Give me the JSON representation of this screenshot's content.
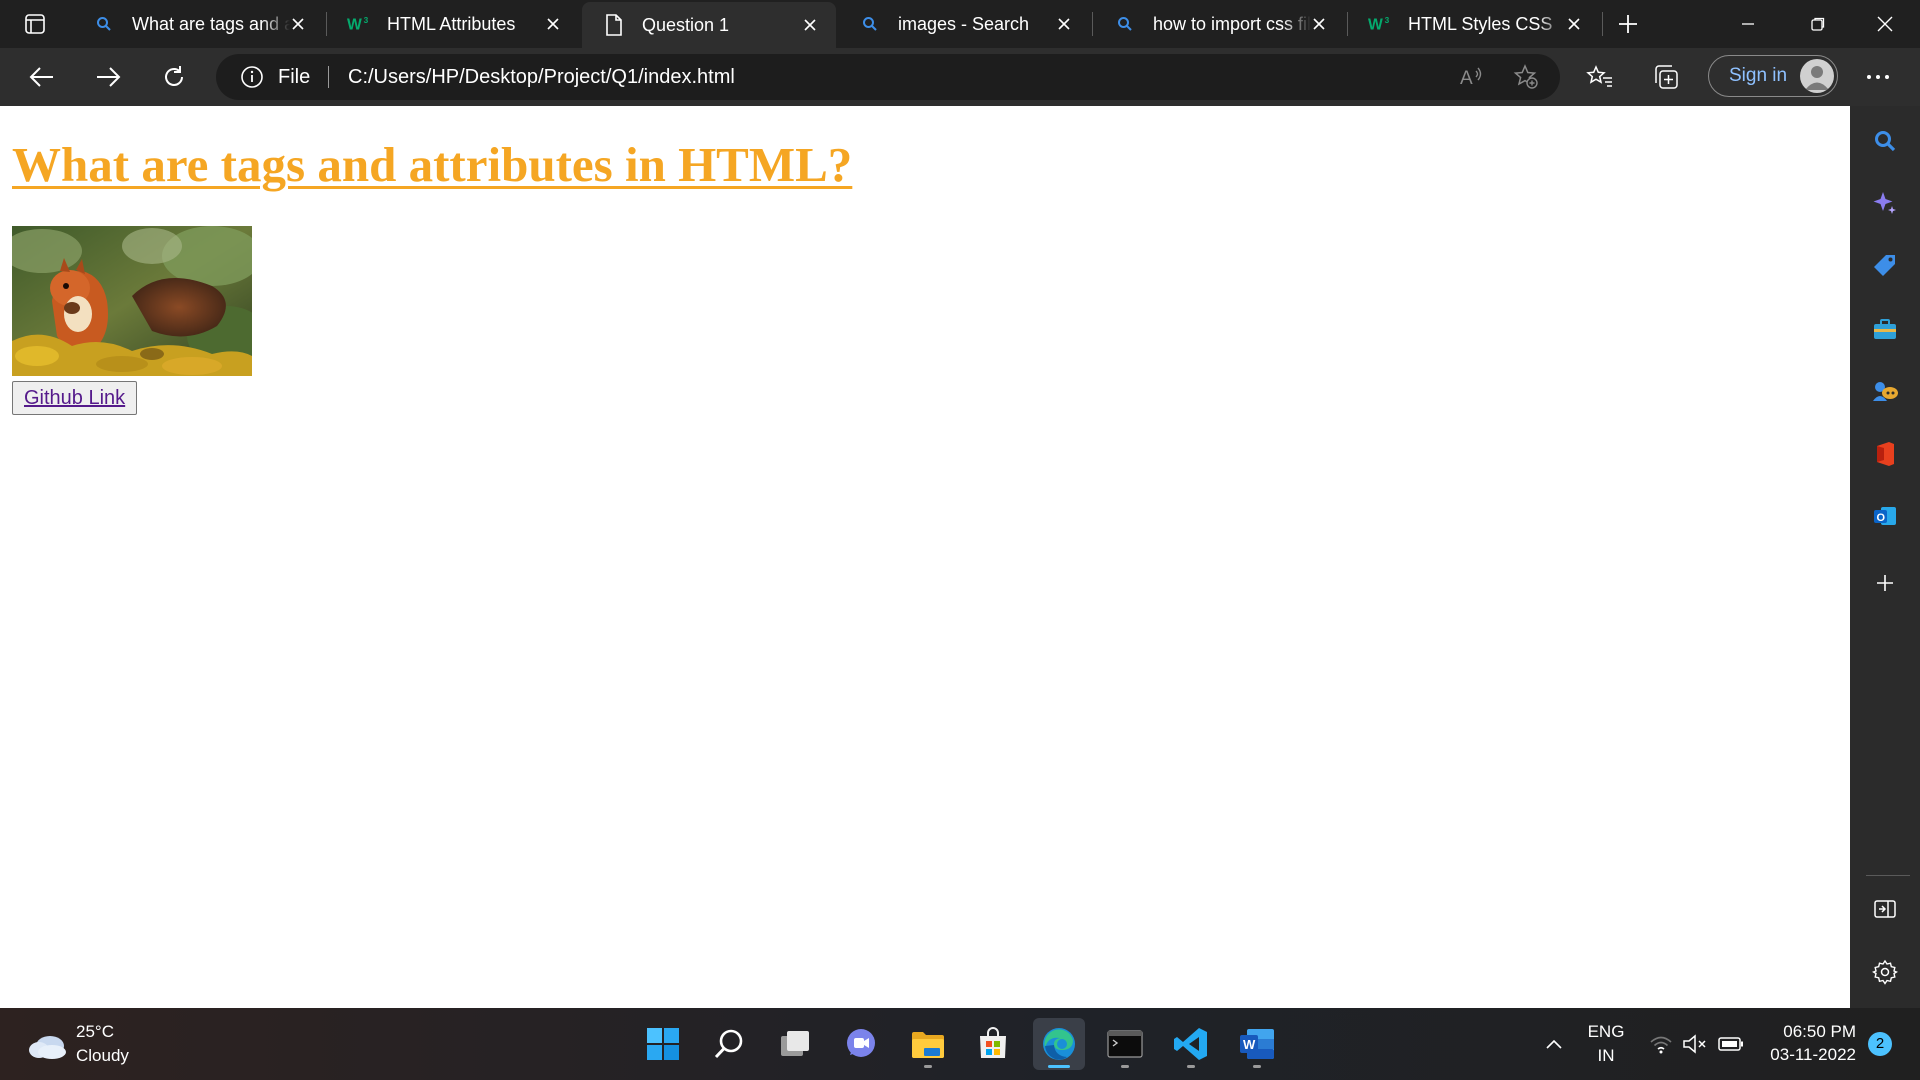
{
  "browser": {
    "tabs": [
      {
        "label": "What are tags and attributes in HTML",
        "icon": "search-icon",
        "active": false
      },
      {
        "label": "HTML Attributes",
        "icon": "w3schools-icon",
        "active": false
      },
      {
        "label": "Question 1",
        "icon": "document-icon",
        "active": true
      },
      {
        "label": "images - Search",
        "icon": "search-icon",
        "active": false
      },
      {
        "label": "how to import css file",
        "icon": "search-icon",
        "active": false
      },
      {
        "label": "HTML Styles CSS",
        "icon": "w3schools-icon",
        "active": false
      }
    ],
    "address": {
      "scheme_label": "File",
      "url": "C:/Users/HP/Desktop/Project/Q1/index.html"
    },
    "signin_label": "Sign in",
    "accent": "#4cc2ff"
  },
  "page": {
    "heading": "What are tags and attributes in HTML?",
    "heading_color": "#f5a623",
    "image_subject": "red squirrel eating in autumn leaves",
    "button_link_label": "Github Link"
  },
  "sidebar": {
    "icons": [
      "search-icon",
      "copilot-icon",
      "shopping-tag-icon",
      "tools-icon",
      "games-icon",
      "office-icon",
      "outlook-icon",
      "add-icon"
    ],
    "bottom_icons": [
      "split-screen-icon",
      "settings-icon"
    ]
  },
  "taskbar": {
    "weather": {
      "temp": "25°C",
      "condition": "Cloudy"
    },
    "apps": [
      "start-icon",
      "search-icon",
      "task-view-icon",
      "teams-chat-icon",
      "file-explorer-icon",
      "store-icon",
      "edge-icon",
      "terminal-icon",
      "vscode-icon",
      "word-icon"
    ],
    "lang_line1": "ENG",
    "lang_line2": "IN",
    "time": "06:50 PM",
    "date": "03-11-2022",
    "notifications": "2"
  }
}
